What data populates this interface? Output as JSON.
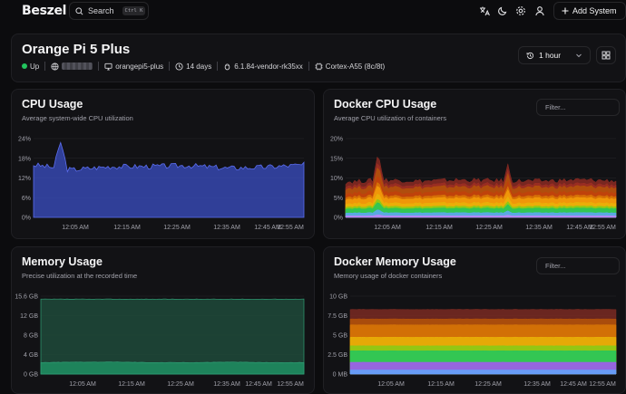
{
  "app": {
    "logo": "Beszel",
    "search_label": "Search",
    "search_kbd": "Ctrl K",
    "add_system_label": "Add System",
    "icons": [
      "translate-icon",
      "theme-icon",
      "settings-icon",
      "user-icon"
    ]
  },
  "system": {
    "name": "Orange Pi 5 Plus",
    "status": "Up",
    "status_color": "#22c55e",
    "host": "orangepi5-plus",
    "uptime": "14 days",
    "kernel": "6.1.84-vendor-rk35xx",
    "cpu": "Cortex-A55 (8c/8t)",
    "time_range": "1 hour"
  },
  "x_ticks": [
    "12:05 AM",
    "12:15 AM",
    "12:25 AM",
    "12:35 AM",
    "12:45 AM",
    "12:55 AM"
  ],
  "cards": {
    "cpu": {
      "title": "CPU Usage",
      "subtitle": "Average system-wide CPU utilization"
    },
    "docker_cpu": {
      "title": "Docker CPU Usage",
      "subtitle": "Average CPU utilization of containers",
      "filter_placeholder": "Filter..."
    },
    "memory": {
      "title": "Memory Usage",
      "subtitle": "Precise utilization at the recorded time"
    },
    "docker_memory": {
      "title": "Docker Memory Usage",
      "subtitle": "Memory usage of docker containers",
      "filter_placeholder": "Filter..."
    }
  },
  "chart_data": [
    {
      "type": "area",
      "y_ticks": [
        "0%",
        "6%",
        "12%",
        "18%",
        "24%"
      ],
      "ylim": [
        0,
        24
      ],
      "x": [
        "12:01 AM",
        "12:05 AM",
        "12:15 AM",
        "12:25 AM",
        "12:35 AM",
        "12:45 AM",
        "12:55 AM",
        "12:58 AM"
      ],
      "color": "#3b4fc4",
      "series": [
        {
          "values": [
            16,
            14.5,
            15.5,
            15.5,
            15.8,
            15,
            15.3,
            16
          ],
          "peak": {
            "at": "12:03 AM",
            "value": 23
          }
        }
      ]
    },
    {
      "type": "area",
      "stacked": true,
      "y_ticks": [
        "0%",
        "5%",
        "10%",
        "15%",
        "20%"
      ],
      "ylim": [
        0,
        20
      ],
      "x": [
        "12:01 AM",
        "12:05 AM",
        "12:15 AM",
        "12:25 AM",
        "12:35 AM",
        "12:45 AM",
        "12:55 AM",
        "12:58 AM"
      ],
      "layer_colors": [
        "#c084fc",
        "#60a5fa",
        "#22c55e",
        "#84cc16",
        "#eab308",
        "#f59e0b",
        "#d97706",
        "#c2410c",
        "#b45309",
        "#9f2f23",
        "#8b2a22"
      ],
      "total": [
        9,
        9.5,
        9.2,
        9.5,
        9.3,
        9.2,
        9.5,
        9.3
      ],
      "peak": {
        "at": "12:06 AM",
        "value": 16.5
      }
    },
    {
      "type": "area",
      "y_ticks": [
        "0 GB",
        "4 GB",
        "8 GB",
        "12 GB",
        "15.6 GB"
      ],
      "ylim": [
        0,
        15.6
      ],
      "x": [
        "12:01 AM",
        "12:05 AM",
        "12:15 AM",
        "12:25 AM",
        "12:35 AM",
        "12:45 AM",
        "12:55 AM",
        "12:58 AM"
      ],
      "series": [
        {
          "values": [
            2.3,
            2.4,
            2.4,
            2.3,
            2.3,
            2.4,
            2.3,
            2.3
          ],
          "color": "#1f8f63"
        },
        {
          "values": [
            15,
            15,
            15,
            15,
            15,
            15,
            15,
            15
          ],
          "color": "#1f4a3a"
        }
      ]
    },
    {
      "type": "area",
      "stacked": true,
      "y_ticks": [
        "0 MB",
        "2.5 GB",
        "5 GB",
        "7.5 GB",
        "10 GB"
      ],
      "ylim": [
        0,
        10
      ],
      "x": [
        "12:01 AM",
        "12:05 AM",
        "12:15 AM",
        "12:25 AM",
        "12:35 AM",
        "12:45 AM",
        "12:55 AM",
        "12:58 AM"
      ],
      "layer_colors": [
        "#60a5fa",
        "#a855f7",
        "#22c55e",
        "#84cc16",
        "#eab308",
        "#d97706",
        "#b45309",
        "#7a2a22"
      ],
      "total": [
        8.3,
        8.3,
        8.3,
        8.3,
        8.3,
        8.3,
        8.3,
        8.3
      ]
    }
  ]
}
